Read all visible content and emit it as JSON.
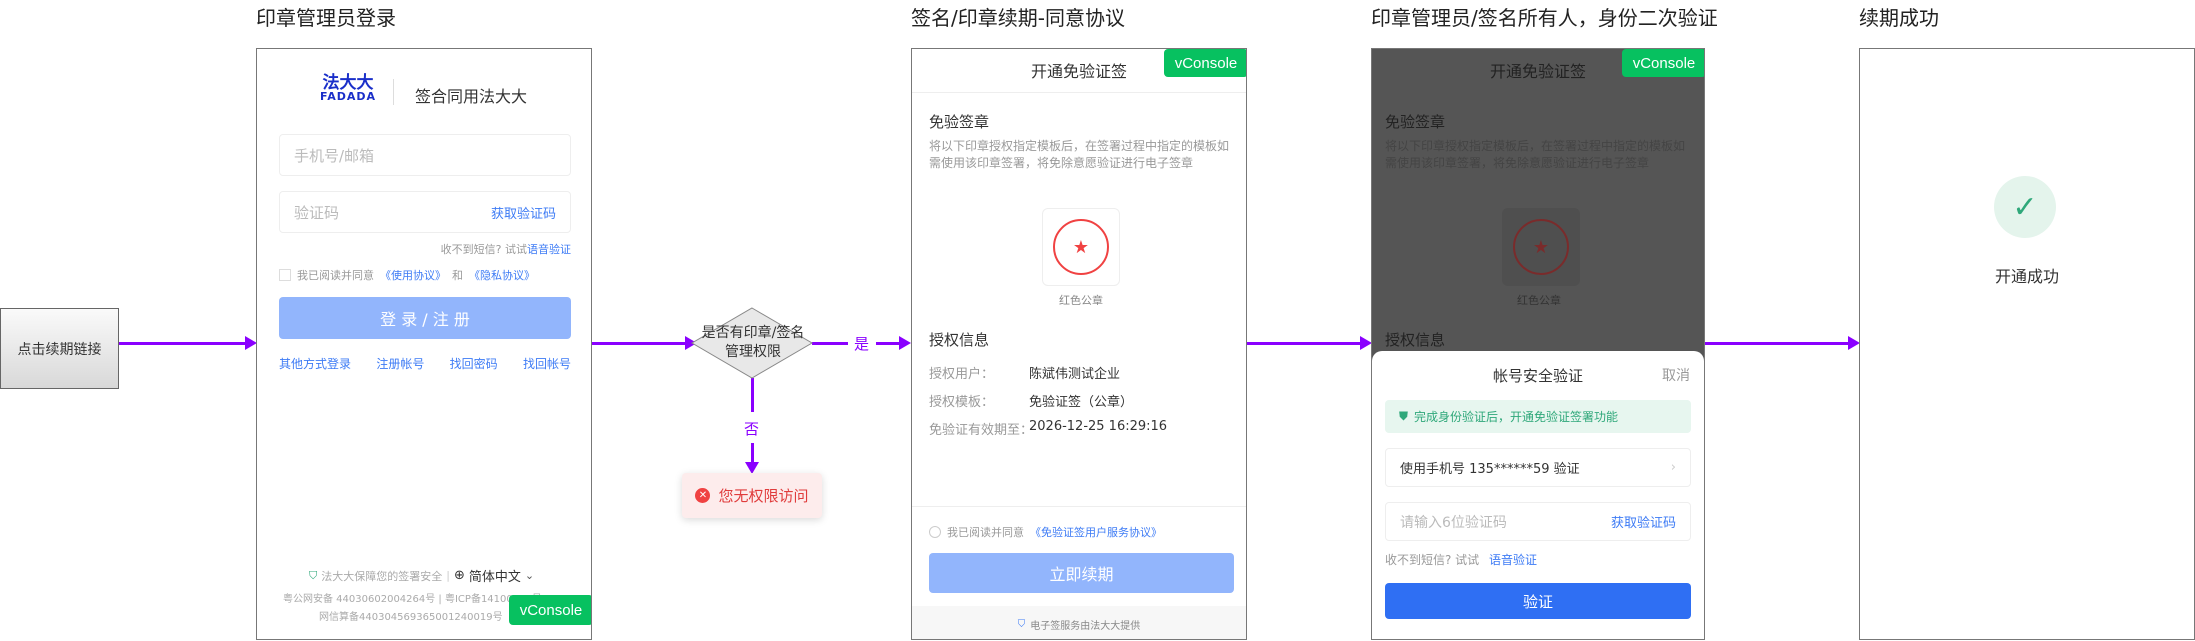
{
  "columns": [
    "印章管理员登录",
    "签名/印章续期-同意协议",
    "印章管理员/签名所有人，身份二次验证",
    "续期成功"
  ],
  "flow": {
    "start": "点击续期链接",
    "decision": "是否有印章/签名管理权限",
    "yes": "是",
    "no": "否",
    "error": "您无权限访问"
  },
  "login": {
    "logo": "法大大 FADADA",
    "slogan": "签合同用法大大",
    "phone_placeholder": "手机号/邮箱",
    "code_placeholder": "验证码",
    "get_code": "获取验证码",
    "no_sms": "收不到短信? 试试",
    "voice": "语音验证",
    "agree": "我已阅读并同意",
    "terms": "《使用协议》",
    "and": "和",
    "privacy": "《隐私协议》",
    "submit": "登 录 / 注 册",
    "links": [
      "其他方式登录",
      "注册帐号",
      "找回密码",
      "找回帐号"
    ],
    "security": "法大大保障您的签署安全",
    "language": "简体中文",
    "icp": "粤公网安备 44030602004264号 | 粤ICP备14100833号",
    "net": "网信算备440304569365001240019号",
    "vconsole": "vConsole"
  },
  "agreement": {
    "title": "开通免验证签",
    "section1": "免验签章",
    "desc": "将以下印章授权指定模板后，在签署过程中指定的模板如需使用该印章签署，将免除意愿验证进行电子签章",
    "seal_name": "红色公章",
    "section2": "授权信息",
    "rows": [
      {
        "label": "授权用户：",
        "value": "陈斌伟测试企业"
      },
      {
        "label": "授权模板：",
        "value": "免验证签（公章）"
      },
      {
        "label": "免验证有效期至：",
        "value": "2026-12-25 16:29:16"
      }
    ],
    "agree": "我已阅读并同意",
    "agreement_link": "《免验证签用户服务协议》",
    "button": "立即续期",
    "footer": "电子签服务由法大大提供",
    "vconsole": "vConsole"
  },
  "verify": {
    "title": "帐号安全验证",
    "cancel": "取消",
    "banner": "完成身份验证后，开通免验证签署功能",
    "phone_option": "使用手机号 135******59 验证",
    "code_placeholder": "请输入6位验证码",
    "get_code": "获取验证码",
    "no_sms": "收不到短信? 试试",
    "voice": "语音验证",
    "button": "验证"
  },
  "success": {
    "text": "开通成功"
  },
  "colors": {
    "arrow": "#8a00ff",
    "primary": "#3d7bf5",
    "disabled": "#92b5fc",
    "success": "#2fa87a",
    "vconsole": "#07c160",
    "error": "#f04242"
  }
}
